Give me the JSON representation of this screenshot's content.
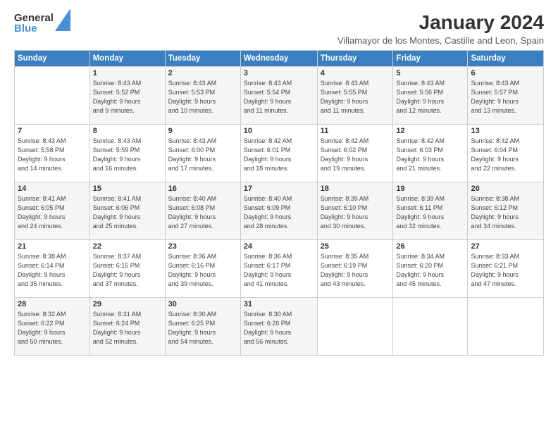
{
  "header": {
    "logo_general": "General",
    "logo_blue": "Blue",
    "month_title": "January 2024",
    "location": "Villamayor de los Montes, Castille and Leon, Spain"
  },
  "weekdays": [
    "Sunday",
    "Monday",
    "Tuesday",
    "Wednesday",
    "Thursday",
    "Friday",
    "Saturday"
  ],
  "weeks": [
    [
      {
        "num": "",
        "sunrise": "",
        "sunset": "",
        "daylight": ""
      },
      {
        "num": "1",
        "sunrise": "Sunrise: 8:43 AM",
        "sunset": "Sunset: 5:52 PM",
        "daylight": "Daylight: 9 hours and 9 minutes."
      },
      {
        "num": "2",
        "sunrise": "Sunrise: 8:43 AM",
        "sunset": "Sunset: 5:53 PM",
        "daylight": "Daylight: 9 hours and 10 minutes."
      },
      {
        "num": "3",
        "sunrise": "Sunrise: 8:43 AM",
        "sunset": "Sunset: 5:54 PM",
        "daylight": "Daylight: 9 hours and 11 minutes."
      },
      {
        "num": "4",
        "sunrise": "Sunrise: 8:43 AM",
        "sunset": "Sunset: 5:55 PM",
        "daylight": "Daylight: 9 hours and 11 minutes."
      },
      {
        "num": "5",
        "sunrise": "Sunrise: 8:43 AM",
        "sunset": "Sunset: 5:56 PM",
        "daylight": "Daylight: 9 hours and 12 minutes."
      },
      {
        "num": "6",
        "sunrise": "Sunrise: 8:43 AM",
        "sunset": "Sunset: 5:57 PM",
        "daylight": "Daylight: 9 hours and 13 minutes."
      }
    ],
    [
      {
        "num": "7",
        "sunrise": "Sunrise: 8:43 AM",
        "sunset": "Sunset: 5:58 PM",
        "daylight": "Daylight: 9 hours and 14 minutes."
      },
      {
        "num": "8",
        "sunrise": "Sunrise: 8:43 AM",
        "sunset": "Sunset: 5:59 PM",
        "daylight": "Daylight: 9 hours and 16 minutes."
      },
      {
        "num": "9",
        "sunrise": "Sunrise: 8:43 AM",
        "sunset": "Sunset: 6:00 PM",
        "daylight": "Daylight: 9 hours and 17 minutes."
      },
      {
        "num": "10",
        "sunrise": "Sunrise: 8:42 AM",
        "sunset": "Sunset: 6:01 PM",
        "daylight": "Daylight: 9 hours and 18 minutes."
      },
      {
        "num": "11",
        "sunrise": "Sunrise: 8:42 AM",
        "sunset": "Sunset: 6:02 PM",
        "daylight": "Daylight: 9 hours and 19 minutes."
      },
      {
        "num": "12",
        "sunrise": "Sunrise: 8:42 AM",
        "sunset": "Sunset: 6:03 PM",
        "daylight": "Daylight: 9 hours and 21 minutes."
      },
      {
        "num": "13",
        "sunrise": "Sunrise: 8:42 AM",
        "sunset": "Sunset: 6:04 PM",
        "daylight": "Daylight: 9 hours and 22 minutes."
      }
    ],
    [
      {
        "num": "14",
        "sunrise": "Sunrise: 8:41 AM",
        "sunset": "Sunset: 6:05 PM",
        "daylight": "Daylight: 9 hours and 24 minutes."
      },
      {
        "num": "15",
        "sunrise": "Sunrise: 8:41 AM",
        "sunset": "Sunset: 6:06 PM",
        "daylight": "Daylight: 9 hours and 25 minutes."
      },
      {
        "num": "16",
        "sunrise": "Sunrise: 8:40 AM",
        "sunset": "Sunset: 6:08 PM",
        "daylight": "Daylight: 9 hours and 27 minutes."
      },
      {
        "num": "17",
        "sunrise": "Sunrise: 8:40 AM",
        "sunset": "Sunset: 6:09 PM",
        "daylight": "Daylight: 9 hours and 28 minutes."
      },
      {
        "num": "18",
        "sunrise": "Sunrise: 8:39 AM",
        "sunset": "Sunset: 6:10 PM",
        "daylight": "Daylight: 9 hours and 30 minutes."
      },
      {
        "num": "19",
        "sunrise": "Sunrise: 8:39 AM",
        "sunset": "Sunset: 6:11 PM",
        "daylight": "Daylight: 9 hours and 32 minutes."
      },
      {
        "num": "20",
        "sunrise": "Sunrise: 8:38 AM",
        "sunset": "Sunset: 6:12 PM",
        "daylight": "Daylight: 9 hours and 34 minutes."
      }
    ],
    [
      {
        "num": "21",
        "sunrise": "Sunrise: 8:38 AM",
        "sunset": "Sunset: 6:14 PM",
        "daylight": "Daylight: 9 hours and 35 minutes."
      },
      {
        "num": "22",
        "sunrise": "Sunrise: 8:37 AM",
        "sunset": "Sunset: 6:15 PM",
        "daylight": "Daylight: 9 hours and 37 minutes."
      },
      {
        "num": "23",
        "sunrise": "Sunrise: 8:36 AM",
        "sunset": "Sunset: 6:16 PM",
        "daylight": "Daylight: 9 hours and 39 minutes."
      },
      {
        "num": "24",
        "sunrise": "Sunrise: 8:36 AM",
        "sunset": "Sunset: 6:17 PM",
        "daylight": "Daylight: 9 hours and 41 minutes."
      },
      {
        "num": "25",
        "sunrise": "Sunrise: 8:35 AM",
        "sunset": "Sunset: 6:19 PM",
        "daylight": "Daylight: 9 hours and 43 minutes."
      },
      {
        "num": "26",
        "sunrise": "Sunrise: 8:34 AM",
        "sunset": "Sunset: 6:20 PM",
        "daylight": "Daylight: 9 hours and 45 minutes."
      },
      {
        "num": "27",
        "sunrise": "Sunrise: 8:33 AM",
        "sunset": "Sunset: 6:21 PM",
        "daylight": "Daylight: 9 hours and 47 minutes."
      }
    ],
    [
      {
        "num": "28",
        "sunrise": "Sunrise: 8:32 AM",
        "sunset": "Sunset: 6:22 PM",
        "daylight": "Daylight: 9 hours and 50 minutes."
      },
      {
        "num": "29",
        "sunrise": "Sunrise: 8:31 AM",
        "sunset": "Sunset: 6:24 PM",
        "daylight": "Daylight: 9 hours and 52 minutes."
      },
      {
        "num": "30",
        "sunrise": "Sunrise: 8:30 AM",
        "sunset": "Sunset: 6:25 PM",
        "daylight": "Daylight: 9 hours and 54 minutes."
      },
      {
        "num": "31",
        "sunrise": "Sunrise: 8:30 AM",
        "sunset": "Sunset: 6:26 PM",
        "daylight": "Daylight: 9 hours and 56 minutes."
      },
      {
        "num": "",
        "sunrise": "",
        "sunset": "",
        "daylight": ""
      },
      {
        "num": "",
        "sunrise": "",
        "sunset": "",
        "daylight": ""
      },
      {
        "num": "",
        "sunrise": "",
        "sunset": "",
        "daylight": ""
      }
    ]
  ]
}
